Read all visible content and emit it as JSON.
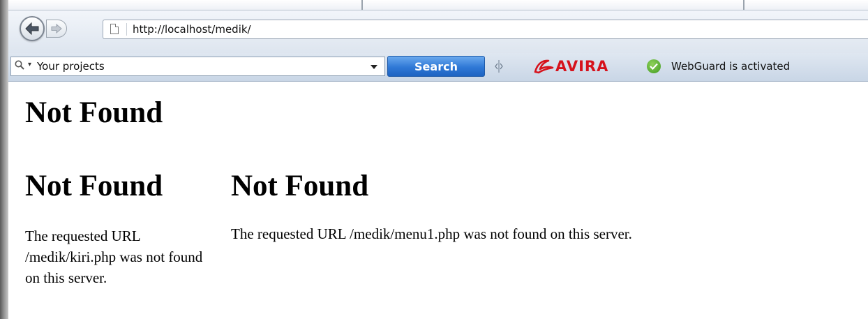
{
  "browser": {
    "url": "http://localhost/medik/",
    "search": {
      "value": "Your projects",
      "button_label": "Search"
    },
    "avira": {
      "logo_text": "AVIRA",
      "status_text": "WebGuard is activated",
      "brand_color": "#d6121c"
    },
    "icons": {
      "back": "back-arrow-icon",
      "forward": "forward-arrow-icon",
      "page": "page-icon",
      "search": "magnifier-icon",
      "dropdown": "chevron-down-icon",
      "grip": "toolbar-grip-icon",
      "status": "check-circle-icon"
    }
  },
  "page": {
    "top_heading": "Not Found",
    "left_frame": {
      "heading": "Not Found",
      "message": "The requested URL /medik/kiri.php was not found on this server."
    },
    "right_frame": {
      "heading": "Not Found",
      "message": "The requested URL /medik/menu1.php was not found on this server."
    }
  }
}
